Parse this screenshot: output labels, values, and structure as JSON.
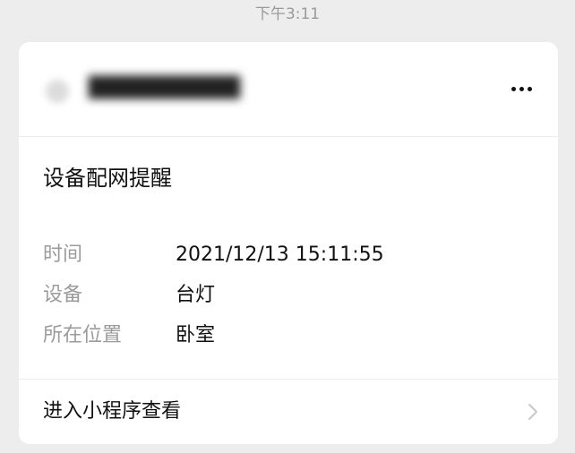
{
  "chat": {
    "timestamp": "下午3:11"
  },
  "card": {
    "sender": {
      "name": "██████████",
      "avatar_icon": "avatar-icon"
    },
    "more_icon": "more-icon",
    "title": "设备配网提醒",
    "details": [
      {
        "label": "时间",
        "value": "2021/12/13 15:11:55"
      },
      {
        "label": "设备",
        "value": "台灯"
      },
      {
        "label": "所在位置",
        "value": "卧室"
      }
    ],
    "footer": {
      "label": "进入小程序查看",
      "icon": "chevron-right-icon"
    }
  },
  "colors": {
    "page_background": "#ededed",
    "card_background": "#ffffff",
    "label_gray": "#9b9b9b",
    "text_dark": "#111111"
  }
}
